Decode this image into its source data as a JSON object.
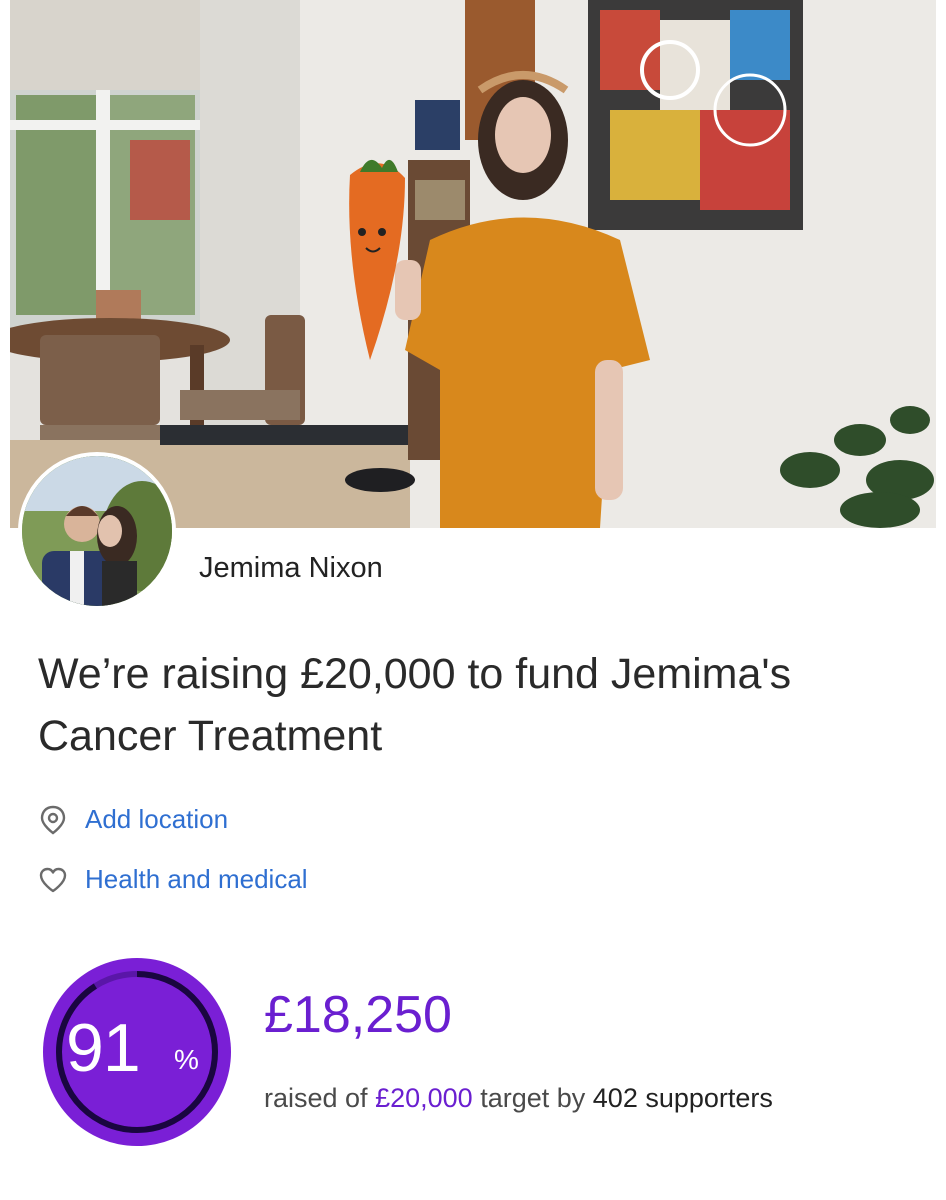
{
  "organiser": {
    "name": "Jemima Nixon"
  },
  "campaign": {
    "title": "We’re raising £20,000 to fund Jemima's Cancer Treatment",
    "location_link": "Add location",
    "category_link": "Health and medical"
  },
  "progress": {
    "percent": 91,
    "percent_label": "91",
    "percent_sign": "%",
    "raised": "£18,250",
    "text_before": "raised of",
    "target": "£20,000",
    "text_middle": "target by",
    "supporters": "402 supporters"
  },
  "icons": {
    "location": "location-pin-icon",
    "category": "heart-icon"
  },
  "colors": {
    "accent": "#6a1fd0",
    "link": "#2f6fd1",
    "ring_dark": "#1a0640"
  }
}
